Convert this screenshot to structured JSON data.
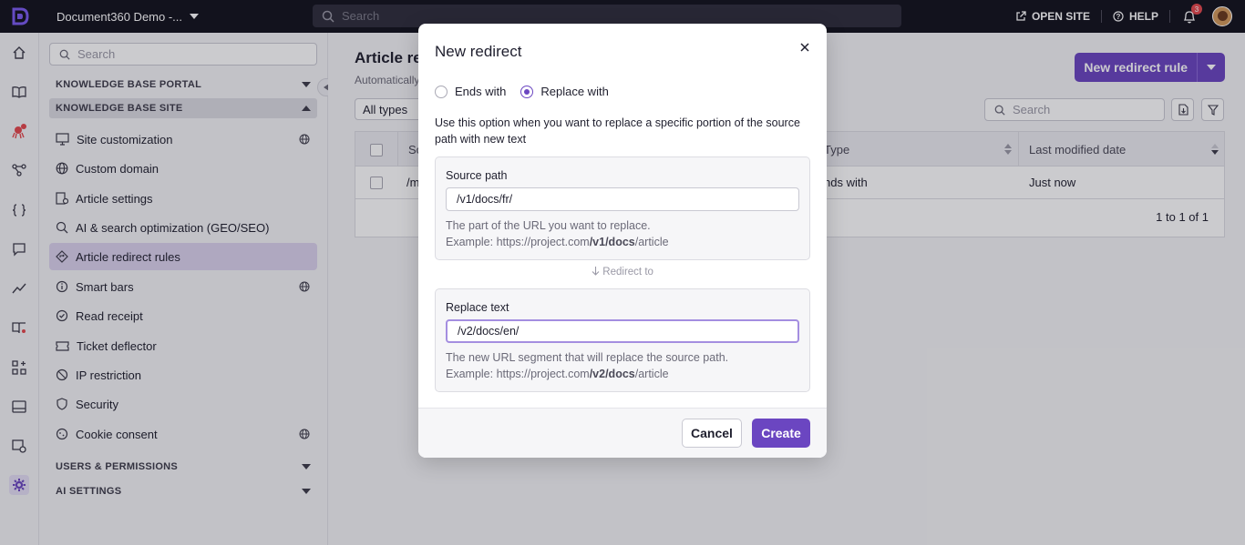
{
  "topbar": {
    "project_name": "Document360 Demo -...",
    "search_placeholder": "Search",
    "open_site": "OPEN SITE",
    "help": "HELP",
    "notifications_count": "3"
  },
  "sidebar": {
    "search_placeholder": "Search",
    "sections": {
      "kb_portal": "KNOWLEDGE BASE PORTAL",
      "kb_site": "KNOWLEDGE BASE SITE",
      "users_permissions": "USERS & PERMISSIONS",
      "ai_settings": "AI SETTINGS"
    },
    "items": [
      {
        "label": "Site customization",
        "icon": "monitor-icon",
        "globe": true
      },
      {
        "label": "Custom domain",
        "icon": "globe-icon",
        "globe": false
      },
      {
        "label": "Article settings",
        "icon": "article-settings-icon",
        "globe": false
      },
      {
        "label": "AI & search optimization (GEO/SEO)",
        "icon": "search-sparkle-icon",
        "globe": false
      },
      {
        "label": "Article redirect rules",
        "icon": "redirect-icon",
        "globe": false,
        "active": true
      },
      {
        "label": "Smart bars",
        "icon": "info-icon",
        "globe": true
      },
      {
        "label": "Read receipt",
        "icon": "check-circle-icon",
        "globe": false
      },
      {
        "label": "Ticket deflector",
        "icon": "ticket-icon",
        "globe": false
      },
      {
        "label": "IP restriction",
        "icon": "block-icon",
        "globe": false
      },
      {
        "label": "Security",
        "icon": "shield-icon",
        "globe": false
      },
      {
        "label": "Cookie consent",
        "icon": "cookie-icon",
        "globe": true
      }
    ]
  },
  "main": {
    "title": "Article re",
    "subtitle": "Automatically",
    "new_rule_button": "New redirect rule",
    "type_filter": "All types",
    "search_placeholder": "Search",
    "columns": {
      "source": "So",
      "type": "Type",
      "modified": "Last modified date"
    },
    "rows": [
      {
        "source": "/m",
        "type": "nds with",
        "modified": "Just now"
      }
    ],
    "pagination": "1 to 1 of 1"
  },
  "modal": {
    "title": "New redirect",
    "radio_ends_with": "Ends with",
    "radio_replace_with": "Replace with",
    "selected": "replace_with",
    "description": "Use this option when you want to replace a specific portion of the source path with new text",
    "source": {
      "label": "Source path",
      "value": "/v1/docs/fr/",
      "help_line1": "The part of the URL you want to replace.",
      "example_prefix": "Example: https://project.com",
      "example_bold": "/v1/docs",
      "example_suffix": "/article"
    },
    "redirect_to": "Redirect to",
    "replace": {
      "label": "Replace text",
      "value": "/v2/docs/en/",
      "help_line1": "The new URL segment that will replace the source path.",
      "example_prefix": "Example: https://project.com",
      "example_bold": "/v2/docs",
      "example_suffix": "/article"
    },
    "cancel": "Cancel",
    "create": "Create"
  },
  "colors": {
    "accent": "#6b46c1",
    "topbar": "#13121d",
    "active_item": "#dcd3ee"
  }
}
